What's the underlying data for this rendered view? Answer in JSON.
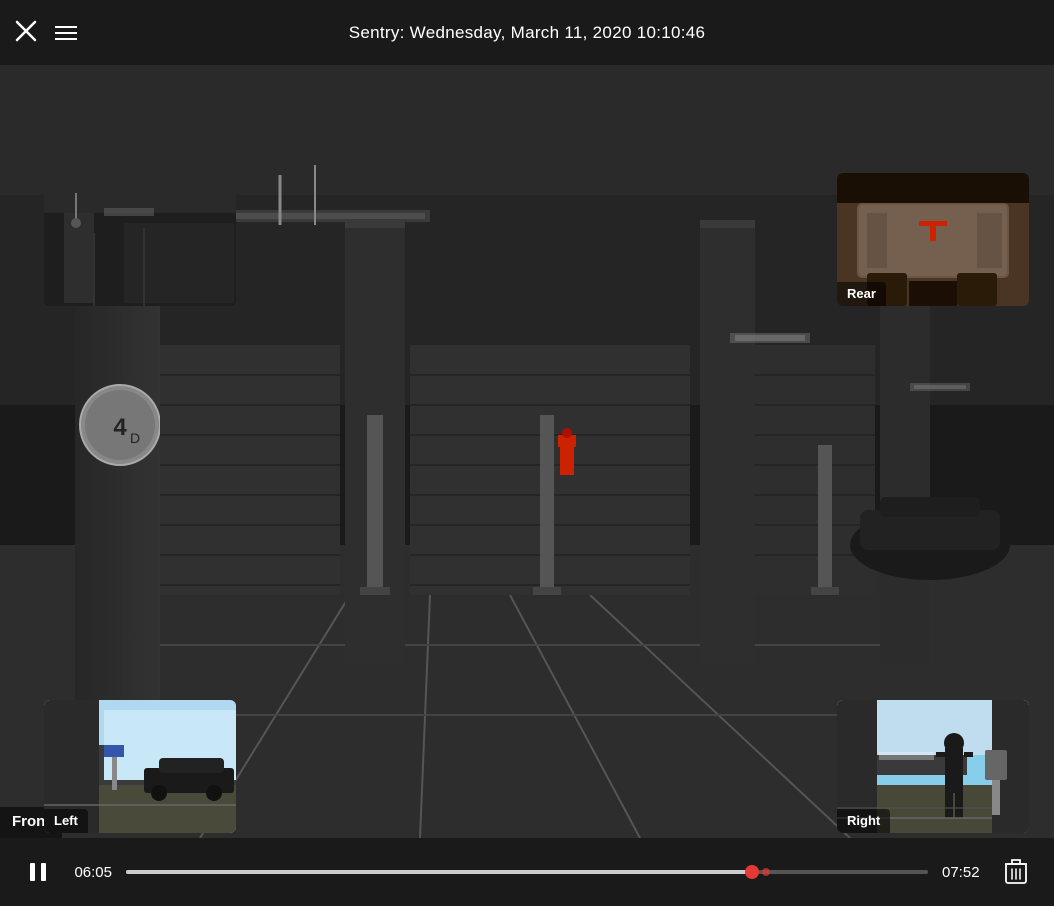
{
  "header": {
    "title": "Sentry: Wednesday, March 11, 2020 10:10:46",
    "close_label": "×",
    "menu_label": "menu"
  },
  "cameras": {
    "front": {
      "label": "Front"
    },
    "rear": {
      "label": "Rear"
    },
    "left": {
      "label": "Left"
    },
    "right": {
      "label": "Right"
    }
  },
  "controls": {
    "current_time": "06:05",
    "total_time": "07:52",
    "pause_icon": "pause",
    "delete_icon": "trash",
    "progress_percent": 78
  }
}
